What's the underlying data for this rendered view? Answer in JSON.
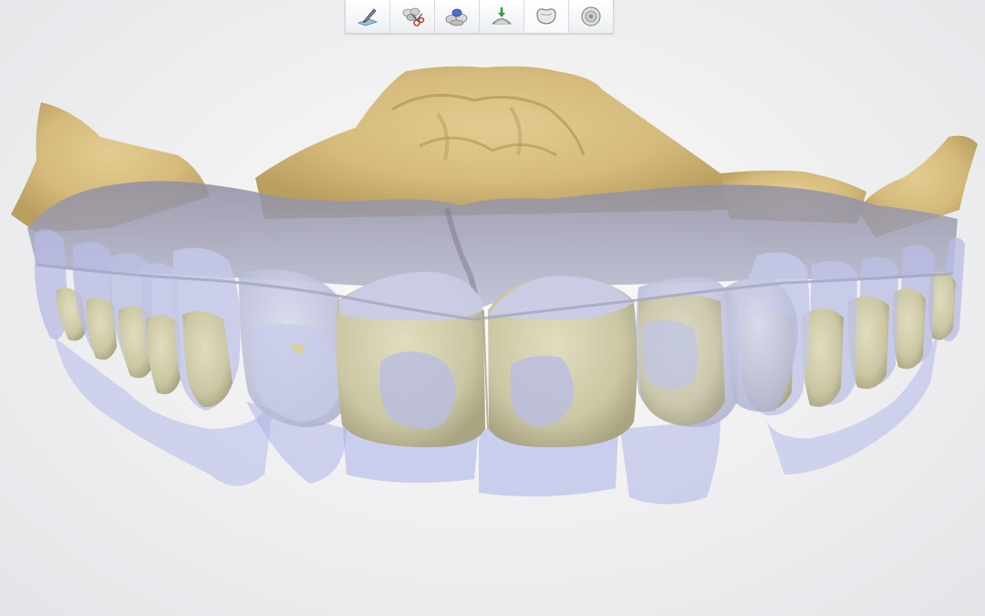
{
  "app": {
    "view": "dental-cad-viewport"
  },
  "toolbar": {
    "steps": [
      {
        "name": "define-margin-step",
        "icon": "margin-pen-icon",
        "active": false
      },
      {
        "name": "cut-model-step",
        "icon": "scissors-teeth-icon",
        "active": false
      },
      {
        "name": "arrange-teeth-step",
        "icon": "teeth-group-icon",
        "active": false
      },
      {
        "name": "insertion-axis-step",
        "icon": "insertion-arrow-icon",
        "active": false
      },
      {
        "name": "design-crown-step",
        "icon": "crown-icon",
        "active": true
      },
      {
        "name": "finish-disk-step",
        "icon": "disk-icon",
        "active": false
      }
    ]
  },
  "colors": {
    "background": "#efeff1",
    "gingiva_scan": "#d8c186",
    "tooth_design": "#d3cfae",
    "transparent_overlay": "#a9b2ea",
    "gum_overlay": "#a4a3b6"
  }
}
